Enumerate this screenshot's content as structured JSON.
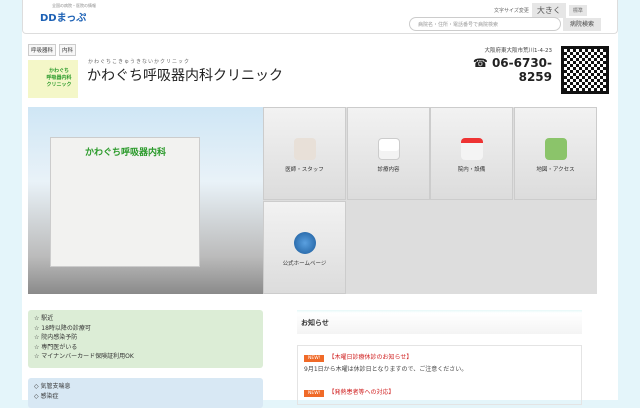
{
  "header": {
    "logo_sub": "全国の病院・医院の情報",
    "logo": "DDまっぷ",
    "font_size_label": "文字サイズ変更",
    "font_large": "大きく",
    "font_standard": "標準",
    "search_placeholder": "病院名・住所・電話番号で病院検索",
    "search_button": "病院検索"
  },
  "clinic": {
    "tags": [
      "呼吸器科",
      "内科"
    ],
    "logo_text": "かわぐち呼吸器内科クリニック",
    "kana": "かわぐちこきゅうきないかクリニック",
    "name": "かわぐち呼吸器内科クリニック",
    "address": "大阪府東大阪市荒川1-4-23",
    "tel": "☎ 06-6730-8259"
  },
  "photo": {
    "sign": "かわぐち呼吸器内科"
  },
  "tiles": [
    {
      "label": "医師・スタッフ",
      "icon": "doctor-icon"
    },
    {
      "label": "診療内容",
      "icon": "medical-kit-icon"
    },
    {
      "label": "院内・設備",
      "icon": "hospital-icon"
    },
    {
      "label": "地図・アクセス",
      "icon": "map-icon"
    },
    {
      "label": "公式ホームページ",
      "icon": "globe-icon"
    }
  ],
  "features": [
    "☆ 駅近",
    "☆ 18時以降の診療可",
    "☆ 院内感染予防",
    "☆ 専門医がいる",
    "☆ マイナンバーカード保険証利用OK"
  ],
  "specialties": [
    "◇ 気管支喘息",
    "◇ 感染症"
  ],
  "news": {
    "heading": "お知らせ",
    "badge": "NEW!",
    "items": [
      {
        "title": "【木曜日診療休診のお知らせ】",
        "body": "9月1日から木曜は休診日となりますので、ご注意ください。"
      },
      {
        "title": "【発熱患者等への対応】",
        "body": ""
      }
    ]
  }
}
